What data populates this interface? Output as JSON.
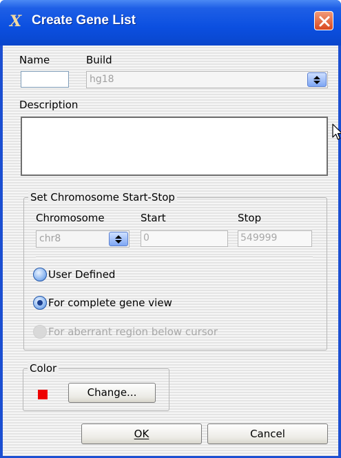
{
  "window": {
    "title": "Create Gene List"
  },
  "icons": {
    "app": "app-logo-icon",
    "close": "close-icon",
    "combo_spin": "spinner-arrows-icon",
    "cursor": "mouse-pointer-icon"
  },
  "colors": {
    "titlebar": "#0b4fe0",
    "close_button": "#d9481f",
    "selected_color": "#ee0000"
  },
  "fields": {
    "name_label": "Name",
    "name_value": "",
    "build_label": "Build",
    "build_value": "hg18",
    "description_label": "Description",
    "description_value": ""
  },
  "chromosome_group": {
    "title": "Set Chromosome Start-Stop",
    "chromosome_label": "Chromosome",
    "chromosome_value": "chr8",
    "start_label": "Start",
    "start_value": "0",
    "stop_label": "Stop",
    "stop_value": "549999",
    "options": [
      {
        "label": "User Defined",
        "checked": false,
        "enabled": true
      },
      {
        "label": "For complete gene view",
        "checked": true,
        "enabled": true
      },
      {
        "label": "For aberrant region below cursor",
        "checked": false,
        "enabled": false
      }
    ]
  },
  "color_group": {
    "title": "Color",
    "change_label": "Change..."
  },
  "buttons": {
    "ok_label": "OK",
    "cancel_label": "Cancel"
  }
}
